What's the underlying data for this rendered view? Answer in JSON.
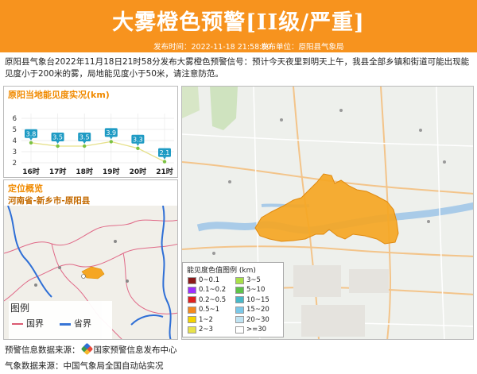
{
  "header": {
    "title": "大雾橙色预警[II级/严重]",
    "publish_time_label": "发布时间：2022-11-18 21:58:00",
    "publisher_label": "发布单位：原阳县气象局"
  },
  "description": "原阳县气象台2022年11月18日21时58分发布大雾橙色预警信号：预计今天夜里到明天上午，我县全部乡镇和街道可能出现能见度小于200米的雾，局地能见度小于50米，请注意防范。",
  "visibility_panel": {
    "title": "原阳当地能见度实况(km)"
  },
  "chart_data": {
    "type": "line",
    "title": "原阳当地能见度实况(km)",
    "categories": [
      "16时",
      "17时",
      "18时",
      "19时",
      "20时",
      "21时"
    ],
    "values": [
      3.8,
      3.5,
      3.5,
      3.9,
      3.3,
      2.1
    ],
    "value_labels": [
      "3.8",
      "3.5",
      "3.5",
      "3.9",
      "3.3",
      "2.1"
    ],
    "ylim": [
      2,
      6
    ],
    "yticks": [
      "2",
      "3",
      "4",
      "5",
      "6"
    ],
    "line_color": "#e6e08a",
    "point_color": "#7cc242",
    "label_color": "#1f9bc4",
    "grid": true
  },
  "location_panel": {
    "title": "定位概览",
    "region": "河南省-新乡市-原阳县",
    "legend_title": "图例",
    "legend_items": [
      {
        "label": "国界",
        "color": "#d9536b"
      },
      {
        "label": "省界",
        "color": "#2f6fd6"
      }
    ]
  },
  "map_legend": {
    "title": "能见度色值图例 (km)",
    "items_left": [
      {
        "label": "0~0.1",
        "color": "#8b1a1a"
      },
      {
        "label": "0.1~0.2",
        "color": "#9b30ff"
      },
      {
        "label": "0.2~0.5",
        "color": "#e0201f"
      },
      {
        "label": "0.5~1",
        "color": "#f48a1e"
      },
      {
        "label": "1~2",
        "color": "#f5d400"
      },
      {
        "label": "2~3",
        "color": "#e8e24a"
      }
    ],
    "items_right": [
      {
        "label": "3~5",
        "color": "#a8e04a"
      },
      {
        "label": "5~10",
        "color": "#5fc24a"
      },
      {
        "label": "10~15",
        "color": "#48b8c8"
      },
      {
        "label": "15~20",
        "color": "#7ac8e8"
      },
      {
        "label": "20~30",
        "color": "#bfe3f2"
      },
      {
        "label": ">=30",
        "color": "#ffffff"
      }
    ]
  },
  "warning_area": {
    "color": "#f5a623"
  },
  "footer": {
    "source1": "预警信息数据来源：",
    "source1_org": "国家预警信息发布中心",
    "source2": "气象数据来源：中国气象局全国自动站实况"
  }
}
